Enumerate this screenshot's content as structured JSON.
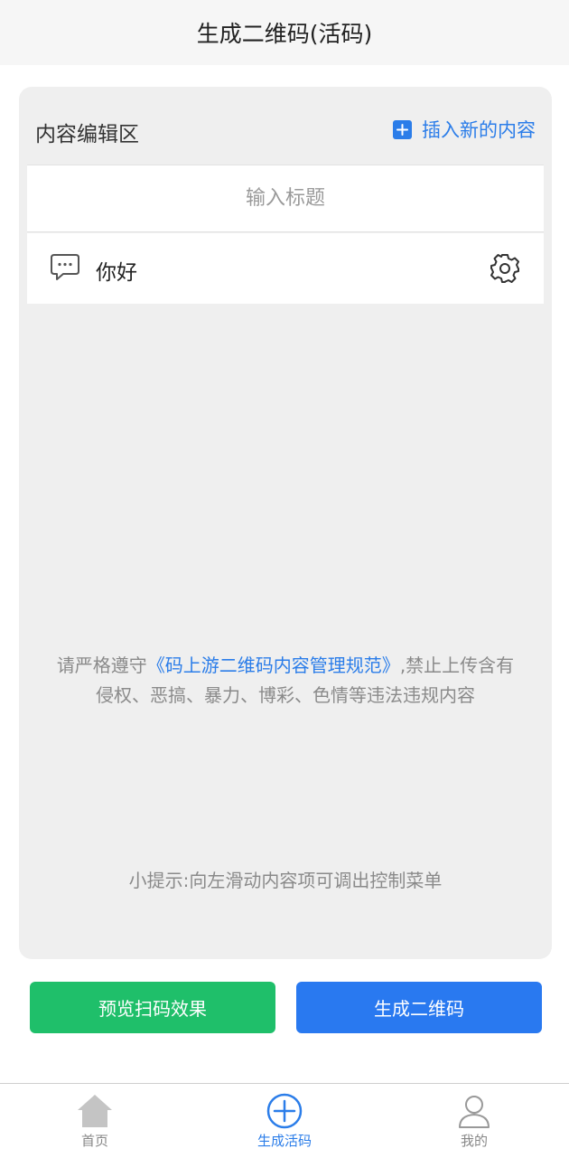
{
  "header": {
    "title": "生成二维码(活码)"
  },
  "editor": {
    "title": "内容编辑区",
    "insert_label": "插入新的内容",
    "title_placeholder": "输入标题",
    "items": [
      {
        "text": "你好",
        "icon": "chat-bubble-icon",
        "action_icon": "gear-icon"
      }
    ]
  },
  "notice": {
    "prefix": "请严格遵守",
    "link": "《码上游二维码内容管理规范》",
    "suffix": ",禁止上传含有侵权、恶搞、暴力、博彩、色情等违法违规内容"
  },
  "tip": "小提示:向左滑动内容项可调出控制菜单",
  "buttons": {
    "preview": "预览扫码效果",
    "generate": "生成二维码"
  },
  "tabbar": {
    "items": [
      {
        "label": "首页",
        "icon": "home-icon",
        "active": false
      },
      {
        "label": "生成活码",
        "icon": "plus-circle-icon",
        "active": true
      },
      {
        "label": "我的",
        "icon": "user-icon",
        "active": false
      }
    ]
  },
  "colors": {
    "accent": "#2b7de9",
    "preview_button": "#1fbf6a",
    "generate_button": "#2979f0",
    "panel_background": "#efefef"
  }
}
